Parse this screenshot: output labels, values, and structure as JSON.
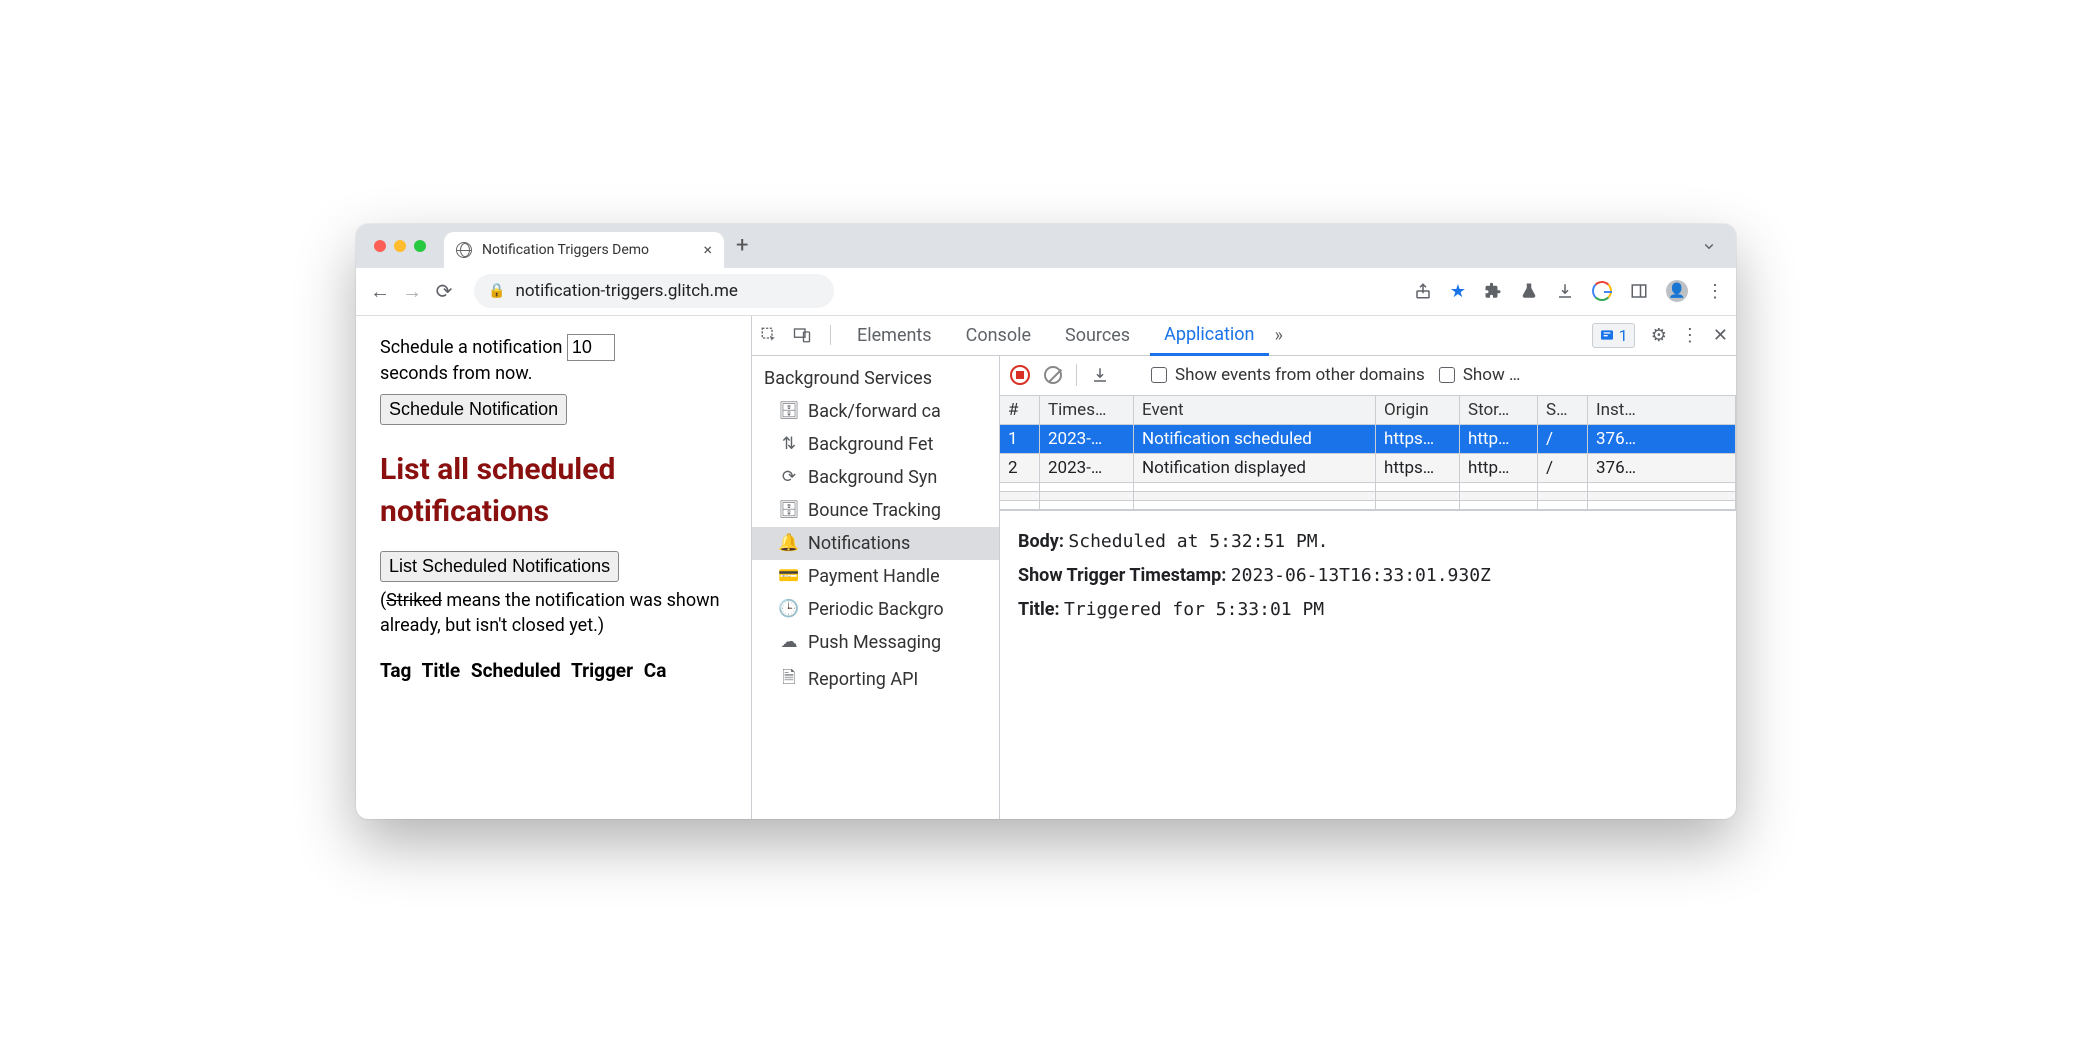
{
  "browser": {
    "tab_title": "Notification Triggers Demo",
    "url_display": "notification-triggers.glitch.me"
  },
  "page": {
    "schedule_prefix": "Schedule a notification",
    "schedule_seconds": "10",
    "schedule_suffix": "seconds from now.",
    "schedule_button": "Schedule Notification",
    "list_heading": "List all scheduled notifications",
    "list_button": "List Scheduled Notifications",
    "hint_open_paren": "(",
    "hint_striked": "Striked",
    "hint_rest": " means the notification was shown already, but isn't closed yet.)",
    "table_headers": [
      "Tag",
      "Title",
      "Scheduled",
      "Trigger",
      "Ca"
    ]
  },
  "devtools": {
    "tabs": {
      "elements": "Elements",
      "console": "Console",
      "sources": "Sources",
      "application": "Application"
    },
    "issue_count": "1",
    "sidebar": {
      "group": "Background Services",
      "items": [
        "Back/forward ca",
        "Background Fet",
        "Background Syn",
        "Bounce Tracking",
        "Notifications",
        "Payment Handle",
        "Periodic Backgro",
        "Push Messaging",
        "Reporting API"
      ]
    },
    "toolbar": {
      "chk1_label": "Show events from other domains",
      "chk2_label": "Show …"
    },
    "table": {
      "headers": [
        "#",
        "Times…",
        "Event",
        "Origin",
        "Stor…",
        "S…",
        "Inst…"
      ],
      "rows": [
        {
          "n": "1",
          "ts": "2023-…",
          "event": "Notification scheduled",
          "origin": "https…",
          "storage": "http…",
          "s": "/",
          "inst": "376…"
        },
        {
          "n": "2",
          "ts": "2023-…",
          "event": "Notification displayed",
          "origin": "https…",
          "storage": "http…",
          "s": "/",
          "inst": "376…"
        }
      ]
    },
    "details": {
      "body_k": "Body:",
      "body_v": "Scheduled at 5:32:51 PM.",
      "trigger_k": "Show Trigger Timestamp:",
      "trigger_v": "2023-06-13T16:33:01.930Z",
      "title_k": "Title:",
      "title_v": "Triggered for 5:33:01 PM"
    }
  }
}
